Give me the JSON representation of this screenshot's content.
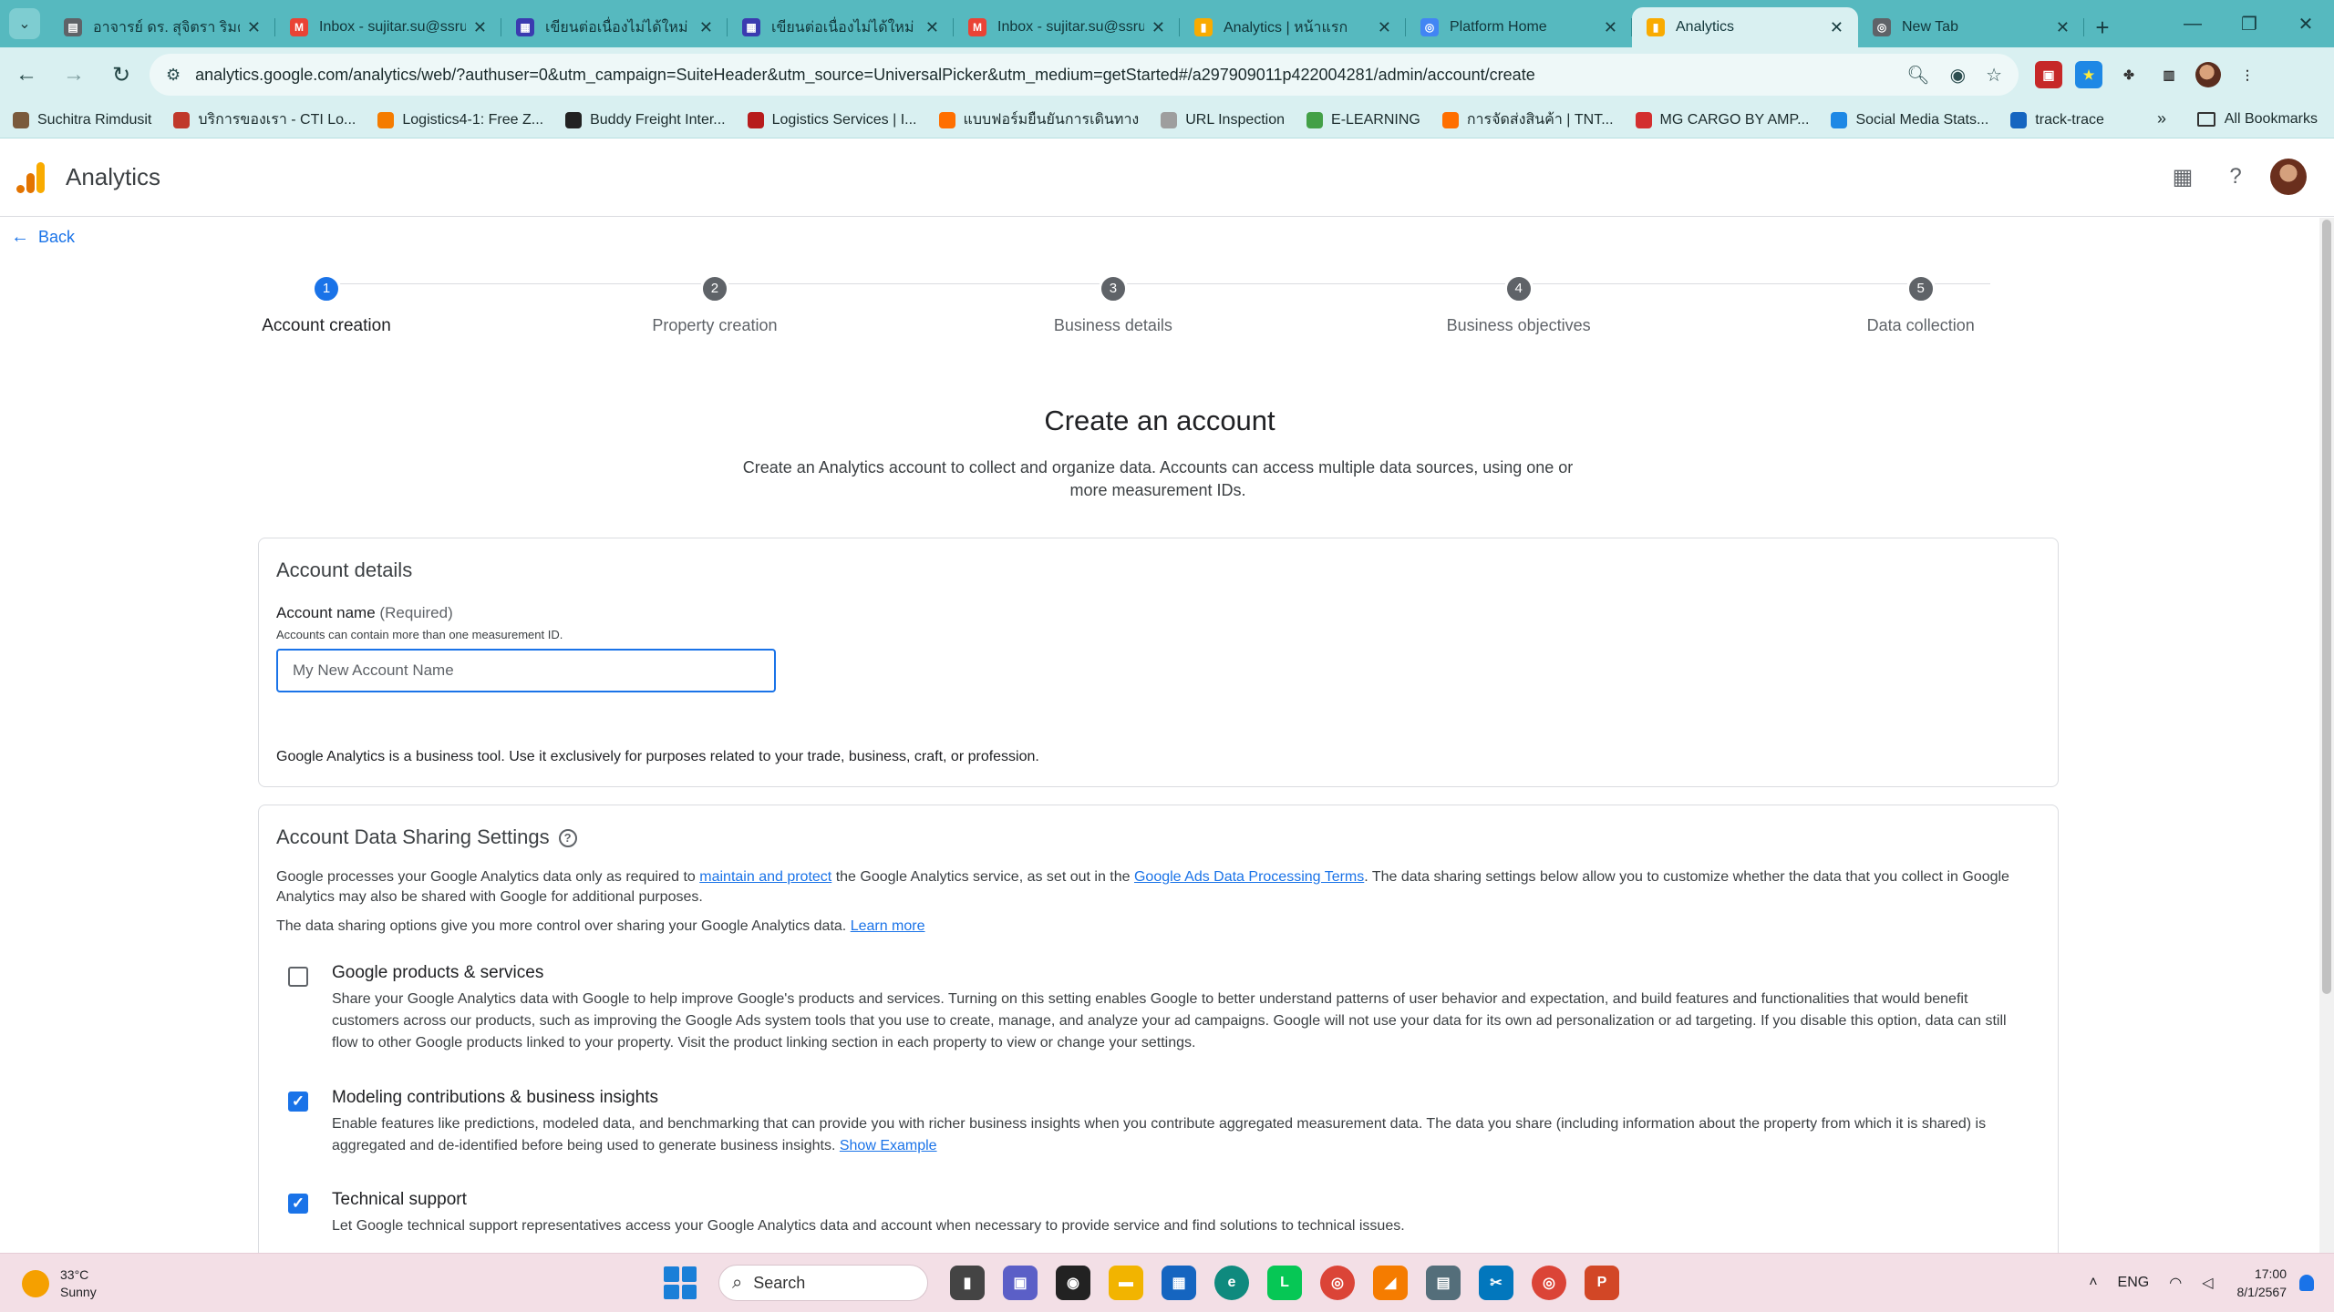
{
  "browser": {
    "tabs": [
      {
        "title": "อาจารย์ ดร. สุจิตรา ริมดุสิ",
        "color": "#5f6368",
        "glyph": "▤"
      },
      {
        "title": "Inbox - sujitar.su@ssru",
        "color": "#ea4335",
        "glyph": "M"
      },
      {
        "title": "เขียนต่อเนื่องไม่ได้ใหม่",
        "color": "#3b3bb0",
        "glyph": "▦"
      },
      {
        "title": "เขียนต่อเนื่องไม่ได้ใหม่",
        "color": "#3b3bb0",
        "glyph": "▦"
      },
      {
        "title": "Inbox - sujitar.su@ssru",
        "color": "#ea4335",
        "glyph": "M"
      },
      {
        "title": "Analytics | หน้าแรก",
        "color": "#f9ab00",
        "glyph": "▮"
      },
      {
        "title": "Platform Home",
        "color": "#4285f4",
        "glyph": "◎"
      },
      {
        "title": "Analytics",
        "color": "#f9ab00",
        "glyph": "▮",
        "active": true
      },
      {
        "title": "New Tab",
        "color": "#5f6368",
        "glyph": "◎"
      }
    ],
    "url": "analytics.google.com/analytics/web/?authuser=0&utm_campaign=SuiteHeader&utm_source=UniversalPicker&utm_medium=getStarted#/a297909011p422004281/admin/account/create",
    "bookmarks": [
      {
        "label": "Suchitra Rimdusit",
        "color": "#7a5a3c"
      },
      {
        "label": "บริการของเรา - CTI Lo...",
        "color": "#c0392b"
      },
      {
        "label": "Logistics4-1: Free Z...",
        "color": "#f57c00"
      },
      {
        "label": "Buddy Freight Inter...",
        "color": "#222222"
      },
      {
        "label": "Logistics Services | I...",
        "color": "#b71c1c"
      },
      {
        "label": "แบบฟอร์มยืนยันการเดินทาง",
        "color": "#ff6f00"
      },
      {
        "label": "URL Inspection",
        "color": "#9e9e9e"
      },
      {
        "label": "E-LEARNING",
        "color": "#43a047"
      },
      {
        "label": "การจัดส่งสินค้า | TNT...",
        "color": "#ff6f00"
      },
      {
        "label": "MG CARGO BY AMP...",
        "color": "#d32f2f"
      },
      {
        "label": "Social Media Stats...",
        "color": "#1e88e5"
      },
      {
        "label": "track-trace",
        "color": "#1565c0"
      }
    ],
    "all_bookmarks": "All Bookmarks"
  },
  "app": {
    "title": "Analytics",
    "back": "Back"
  },
  "stepper": [
    {
      "num": "1",
      "label": "Account creation",
      "active": true
    },
    {
      "num": "2",
      "label": "Property creation"
    },
    {
      "num": "3",
      "label": "Business details"
    },
    {
      "num": "4",
      "label": "Business objectives"
    },
    {
      "num": "5",
      "label": "Data collection"
    }
  ],
  "page": {
    "heading": "Create an account",
    "subheading": "Create an Analytics account to collect and organize data. Accounts can access multiple data sources, using one or more measurement IDs."
  },
  "account_details": {
    "title": "Account details",
    "field_label": "Account name",
    "required": "(Required)",
    "help": "Accounts can contain more than one measurement ID.",
    "placeholder": "My New Account Name",
    "value": "",
    "business_note": "Google Analytics is a business tool. Use it exclusively for purposes related to your trade, business, craft, or profession."
  },
  "sharing": {
    "title": "Account Data Sharing Settings",
    "p1_a": "Google processes your Google Analytics data only as required to ",
    "p1_link1": "maintain and protect",
    "p1_b": " the Google Analytics service, as set out in the ",
    "p1_link2": "Google Ads Data Processing Terms",
    "p1_c": ". The data sharing settings below allow you to customize whether the data that you collect in Google Analytics may also be shared with Google for additional purposes.",
    "p2": "The data sharing options give you more control over sharing your Google Analytics data. ",
    "p2_link": "Learn more",
    "options": [
      {
        "title": "Google products & services",
        "checked": false,
        "desc": "Share your Google Analytics data with Google to help improve Google's products and services. Turning on this setting enables Google to better understand patterns of user behavior and expectation, and build features and functionalities that would benefit customers across our products, such as improving the Google Ads system tools that you use to create, manage, and analyze your ad campaigns. Google will not use your data for its own ad personalization or ad targeting. If you disable this option, data can still flow to other Google products linked to your property. Visit the product linking section in each property to view or change your settings."
      },
      {
        "title": "Modeling contributions & business insights",
        "checked": true,
        "desc": "Enable features like predictions, modeled data, and benchmarking that can provide you with richer business insights when you contribute aggregated measurement data. The data you share (including information about the property from which it is shared) is aggregated and de-identified before being used to generate business insights. ",
        "link": "Show Example"
      },
      {
        "title": "Technical support",
        "checked": true,
        "desc": "Let Google technical support representatives access your Google Analytics data and account when necessary to provide service and find solutions to technical issues."
      }
    ]
  },
  "taskbar": {
    "temp": "33°C",
    "condition": "Sunny",
    "search": "Search",
    "lang": "ENG",
    "time": "17:00",
    "date": "8/1/2567"
  }
}
